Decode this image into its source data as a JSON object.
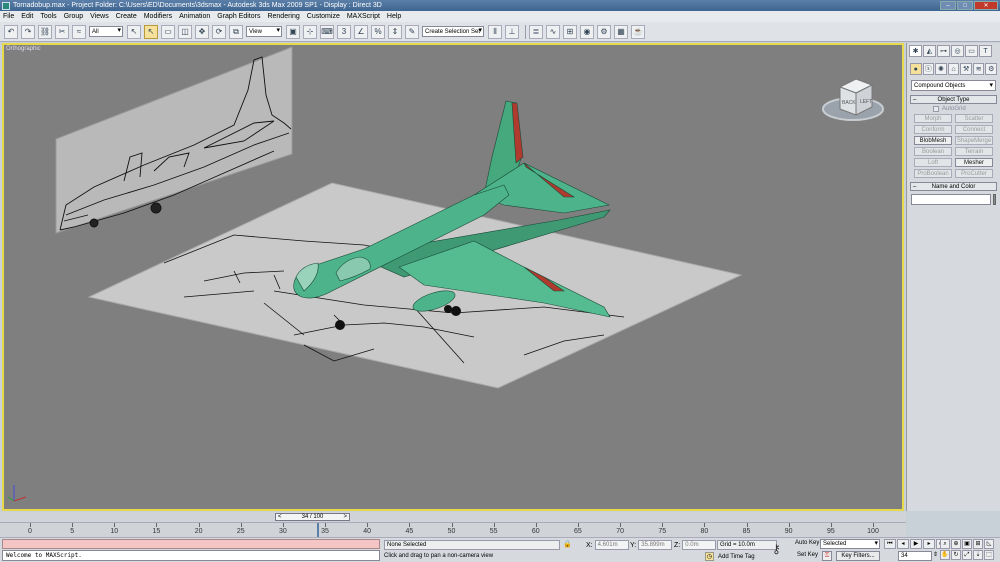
{
  "window": {
    "title": "Tornadobup.max     - Project Folder: C:\\Users\\ED\\Documents\\3dsmax     - Autodesk 3ds Max  2009 SP1     - Display : Direct 3D",
    "buttons": [
      "–",
      "□",
      "✕"
    ]
  },
  "menu": [
    "File",
    "Edit",
    "Tools",
    "Group",
    "Views",
    "Create",
    "Modifiers",
    "Animation",
    "Graph Editors",
    "Rendering",
    "Customize",
    "MAXScript",
    "Help"
  ],
  "toolbar": {
    "filter_value": "All",
    "refcoord_value": "View",
    "named_selection_placeholder": "Create Selection Set"
  },
  "viewport": {
    "label": "Orthographic",
    "viewcube_faces": [
      "BACK",
      "LEFT"
    ]
  },
  "command_panel": {
    "category_dropdown": "Compound Objects",
    "object_type_header": "Object Type",
    "autogrid_label": "AutoGrid",
    "object_buttons": [
      {
        "label": "Morph",
        "enabled": false
      },
      {
        "label": "Scatter",
        "enabled": false
      },
      {
        "label": "Conform",
        "enabled": false
      },
      {
        "label": "Connect",
        "enabled": false
      },
      {
        "label": "BlobMesh",
        "enabled": true
      },
      {
        "label": "ShapeMerge",
        "enabled": false
      },
      {
        "label": "Boolean",
        "enabled": false
      },
      {
        "label": "Terrain",
        "enabled": false
      },
      {
        "label": "Loft",
        "enabled": false
      },
      {
        "label": "Mesher",
        "enabled": true
      },
      {
        "label": "ProBoolean",
        "enabled": false
      },
      {
        "label": "ProCutter",
        "enabled": false
      }
    ],
    "name_color_header": "Name and Color",
    "name_value": "",
    "color": "#8a8a8a"
  },
  "timeline": {
    "current_frame": 34,
    "total_frames": 100,
    "slider_text": "34 / 100",
    "ticks": [
      "0",
      "5",
      "10",
      "15",
      "20",
      "25",
      "30",
      "35",
      "40",
      "45",
      "50",
      "55",
      "60",
      "65",
      "70",
      "75",
      "80",
      "85",
      "90",
      "95",
      "100"
    ]
  },
  "status": {
    "maxscript_output": "",
    "maxscript_listener": "Welcome to MAXScript.",
    "selection_status": "None Selected",
    "prompt": "Click and drag to pan a non-camera view",
    "x_label": "X:",
    "x_value": "4.601m",
    "y_label": "Y:",
    "y_value": "35.899m",
    "z_label": "Z:",
    "z_value": "0.0m",
    "grid": "Grid = 10.0m",
    "add_time_tag": "Add Time Tag",
    "auto_key": "Auto Key",
    "set_key": "Set Key",
    "key_mode_value": "Selected",
    "key_filters": "Key Filters...",
    "frame_field": "34"
  },
  "colors": {
    "viewport_bg": "#7f7f7f",
    "active_border": "#e8d94b",
    "plane_color": "#4db38a",
    "plane_accent": "#c0392b"
  }
}
